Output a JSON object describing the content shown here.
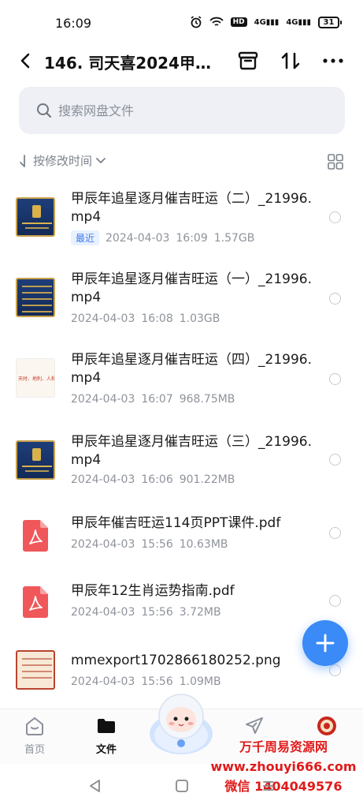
{
  "status_bar": {
    "time": "16:09",
    "hd_label": "HD",
    "signal1": "4G",
    "signal2": "4G",
    "battery": "31"
  },
  "header": {
    "title": "146. 司天喜2024甲…",
    "icons": [
      "back-arrow-icon",
      "archive-box-icon",
      "sort-arrows-icon",
      "more-dots-icon"
    ]
  },
  "search": {
    "placeholder": "搜索网盘文件"
  },
  "sort": {
    "label": "按修改时间"
  },
  "files": [
    {
      "name": "甲辰年追星逐月催吉旺运（二）_21996.mp4",
      "tag": "最近",
      "date": "2024-04-03",
      "time": "16:09",
      "size": "1.57GB",
      "type": "video"
    },
    {
      "name": "甲辰年追星逐月催吉旺运（一）_21996.mp4",
      "tag": "",
      "date": "2024-04-03",
      "time": "16:08",
      "size": "1.03GB",
      "type": "video"
    },
    {
      "name": "甲辰年追星逐月催吉旺运（四）_21996.mp4",
      "tag": "",
      "date": "2024-04-03",
      "time": "16:07",
      "size": "968.75MB",
      "type": "video"
    },
    {
      "name": "甲辰年追星逐月催吉旺运（三）_21996.mp4",
      "tag": "",
      "date": "2024-04-03",
      "time": "16:06",
      "size": "901.22MB",
      "type": "video"
    },
    {
      "name": "甲辰年催吉旺运114页PPT课件.pdf",
      "tag": "",
      "date": "2024-04-03",
      "time": "15:56",
      "size": "10.63MB",
      "type": "pdf"
    },
    {
      "name": "甲辰年12生肖运势指南.pdf",
      "tag": "",
      "date": "2024-04-03",
      "time": "15:56",
      "size": "3.72MB",
      "type": "pdf"
    },
    {
      "name": "mmexport1702866180252.png",
      "tag": "",
      "date": "2024-04-03",
      "time": "15:56",
      "size": "1.09MB",
      "type": "image"
    }
  ],
  "thumb_text": {
    "file3": "天时、地利、人和"
  },
  "nav": {
    "home": "首页",
    "files": "文件"
  },
  "watermark": {
    "line1": "万千周易资源网",
    "line2": "www.zhouyi666.com",
    "line3": "微信 1404049576"
  },
  "colors": {
    "accent": "#3a8af7",
    "tag_text": "#3f7de8",
    "watermark": "#e01a1a",
    "pdf_red": "#f0575a"
  }
}
